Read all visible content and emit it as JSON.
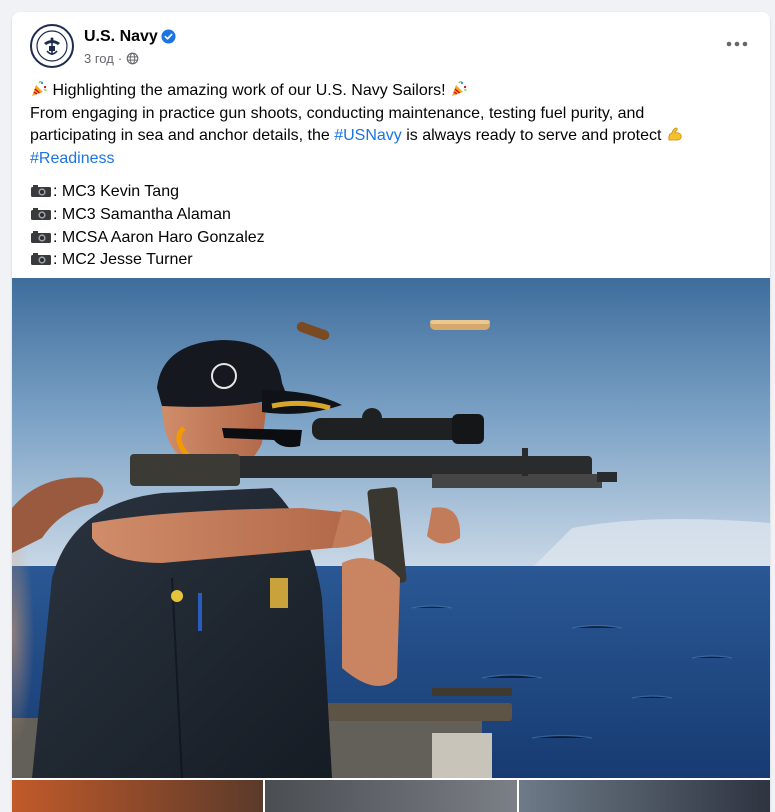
{
  "post": {
    "author": "U.S. Navy",
    "time": "3 год",
    "separator": "·",
    "line1_text": "Highlighting the amazing work of our U.S. Navy Sailors!",
    "line2_text": " From engaging in practice gun shoots, conducting maintenance, testing fuel purity, and",
    "line3_text": "participating in sea and anchor details, the ",
    "line3_hashtag": "#USNavy",
    "line3_tail": " is always ready to serve and protect ",
    "line4_hashtag": "#Readiness",
    "credits": [
      ": MC3 Kevin Tang",
      ": MC3 Samantha Alaman",
      ": MCSA Aaron Haro Gonzalez",
      ": MC2 Jesse Turner"
    ]
  },
  "icons": {
    "avatar": "navy-seal-logo",
    "verified": "verified-badge-icon",
    "privacy": "globe-icon",
    "more": "more-options-icon",
    "line_emoji": "party-popper-icon",
    "end_emoji": "flexed-biceps-icon",
    "credit_emoji": "camera-icon"
  },
  "colors": {
    "hashtag": "#1b74e4",
    "verified": "#1b74e4",
    "secondary_text": "#65676b",
    "sky_top": "#3f6e9c",
    "sea": "#1e4a86"
  }
}
